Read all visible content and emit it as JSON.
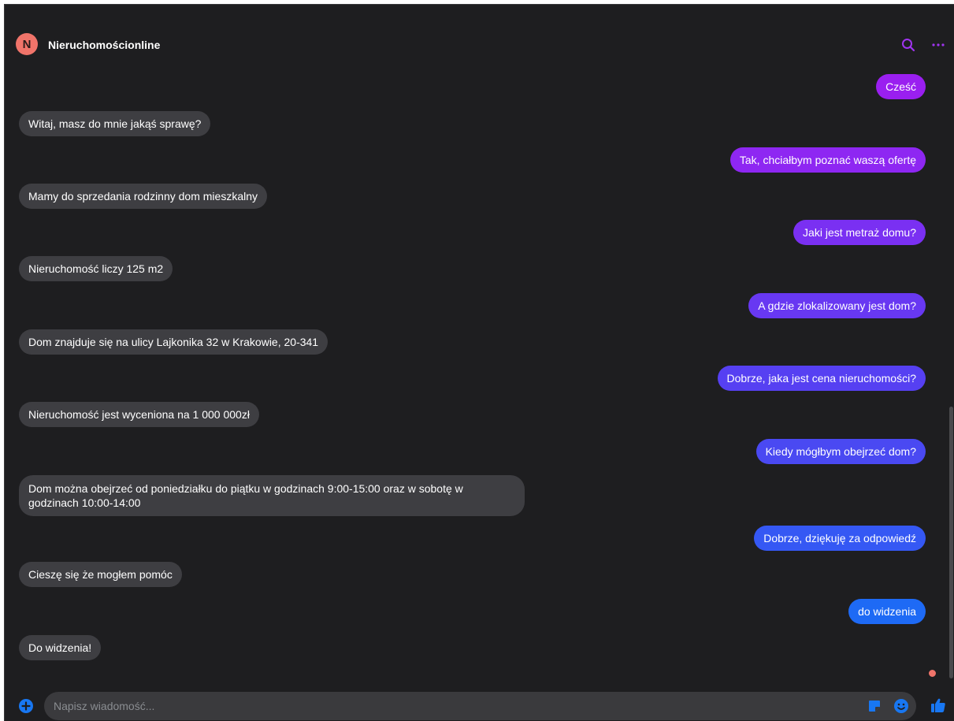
{
  "header": {
    "avatar_initial": "N",
    "title": "Nieruchomościonline",
    "accent_color": "#a034f0"
  },
  "messages": [
    {
      "side": "out",
      "text": "Cześć",
      "color": "#9a1ff0"
    },
    {
      "side": "in",
      "text": "Witaj, masz do mnie jakąś sprawę?"
    },
    {
      "side": "out",
      "text": "Tak, chciałbym poznać waszą ofertę",
      "color": "#8e27f2"
    },
    {
      "side": "in",
      "text": "Mamy do sprzedania rodzinny dom mieszkalny"
    },
    {
      "side": "out",
      "text": "Jaki jest metraż domu?",
      "color": "#7a30f2"
    },
    {
      "side": "in",
      "text": "Nieruchomość liczy 125 m2"
    },
    {
      "side": "out",
      "text": "A gdzie zlokalizowany jest dom?",
      "color": "#6838f2"
    },
    {
      "side": "in",
      "text": "Dom znajduje się na ulicy Lajkonika 32 w  Krakowie, 20-341"
    },
    {
      "side": "out",
      "text": "Dobrze, jaka jest cena nieruchomości?",
      "color": "#5640f2"
    },
    {
      "side": "in",
      "text": "Nieruchomość jest wyceniona na 1 000 000zł"
    },
    {
      "side": "out",
      "text": "Kiedy mógłbym obejrzeć dom?",
      "color": "#4a49f2"
    },
    {
      "side": "in",
      "text": "Dom można obejrzeć od poniedziałku do piątku w godzinach 9:00-15:00 oraz w sobotę w godzinach 10:00-14:00"
    },
    {
      "side": "out",
      "text": "Dobrze, dziękuję za odpowiedź",
      "color": "#3558f4"
    },
    {
      "side": "in",
      "text": "Cieszę się że mogłem pomóc"
    },
    {
      "side": "out",
      "text": "do widzenia",
      "color": "#1e6af5"
    },
    {
      "side": "in",
      "text": "Do widzenia!"
    }
  ],
  "composer": {
    "placeholder": "Napisz wiadomość...",
    "icon_color": "#1877f2"
  }
}
